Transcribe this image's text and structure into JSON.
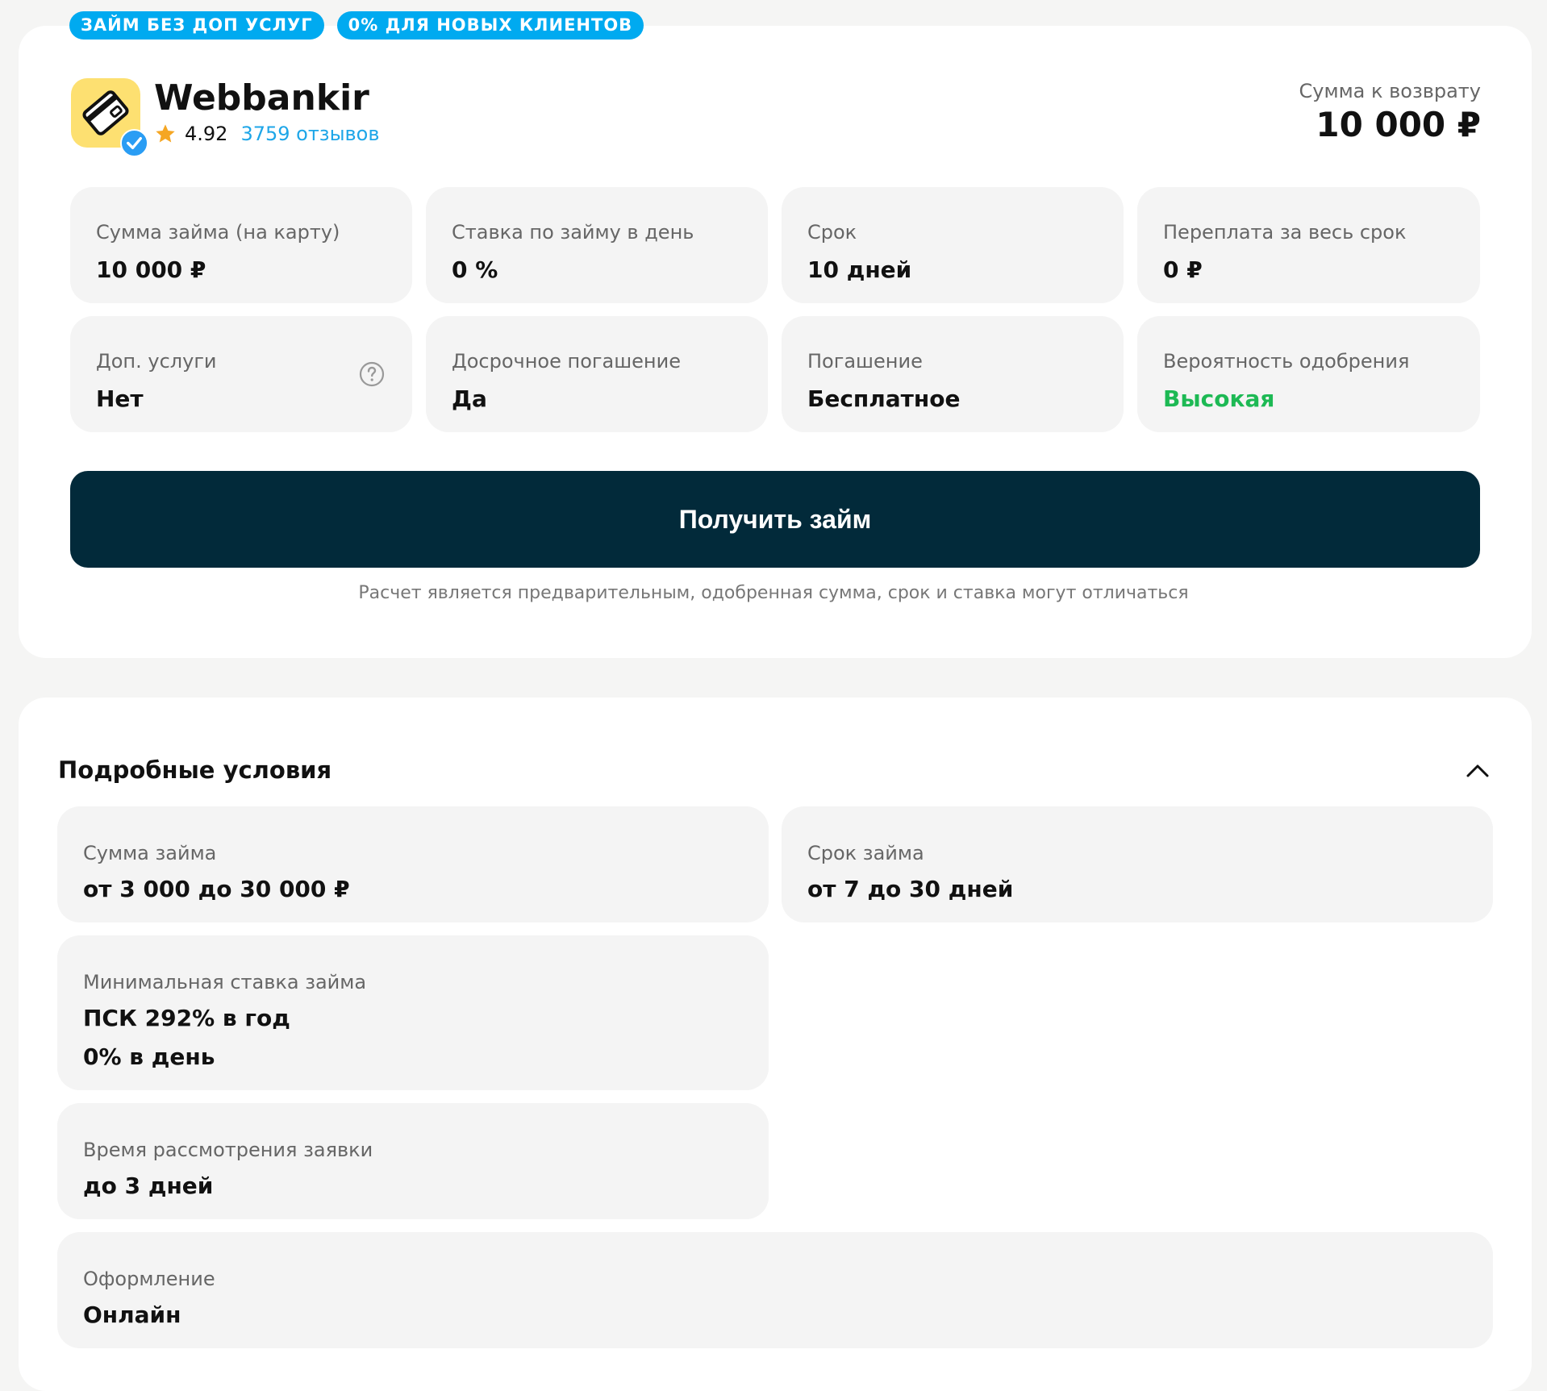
{
  "badges": [
    "ЗАЙМ БЕЗ ДОП УСЛУГ",
    "0% ДЛЯ НОВЫХ КЛИЕНТОВ"
  ],
  "lender": {
    "name": "Webbankir",
    "rating": "4.92",
    "reviews": "3759 отзывов"
  },
  "return_amount": {
    "label": "Сумма к возврату",
    "value": "10 000 ₽"
  },
  "summary": [
    {
      "label": "Сумма займа (на карту)",
      "value": "10 000 ₽"
    },
    {
      "label": "Ставка по займу в день",
      "value": "0 %"
    },
    {
      "label": "Срок",
      "value": "10 дней"
    },
    {
      "label": "Переплата за весь срок",
      "value": "0 ₽"
    },
    {
      "label": "Доп. услуги",
      "value": "Нет"
    },
    {
      "label": "Досрочное погашение",
      "value": "Да"
    },
    {
      "label": "Погашение",
      "value": "Бесплатное"
    },
    {
      "label": "Вероятность одобрения",
      "value": "Высокая"
    }
  ],
  "cta": {
    "label": "Получить займ",
    "disclaimer": "Расчет является предварительным, одобренная сумма, срок и ставка могут отличаться"
  },
  "details": {
    "title": "Подробные условия",
    "loan_amount": {
      "label": "Сумма займа",
      "value": "от 3 000 до 30 000 ₽"
    },
    "loan_term": {
      "label": "Срок займа",
      "value": "от 7 до 30 дней"
    },
    "min_rate": {
      "label": "Минимальная ставка займа",
      "value1": "ПСК 292% в год",
      "value2": "0% в день"
    },
    "review_time": {
      "label": "Время рассмотрения заявки",
      "value": "до 3 дней"
    },
    "application": {
      "label": "Оформление",
      "value": "Онлайн"
    }
  },
  "colors": {
    "badge": "#00aaf0",
    "cta": "#022a3a",
    "approval": "#1db954",
    "link": "#1ea6e8",
    "logo_bg": "#fde071"
  }
}
